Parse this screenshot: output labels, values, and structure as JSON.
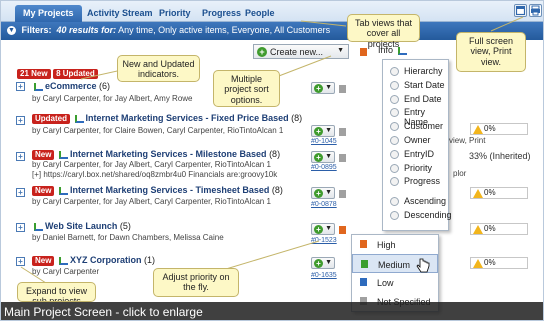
{
  "tabs": [
    {
      "label": "My Projects",
      "active": true
    },
    {
      "label": "Activity Stream",
      "active": false
    },
    {
      "label": "Priority",
      "active": false
    },
    {
      "label": "Progress",
      "active": false
    },
    {
      "label": "People",
      "active": false
    }
  ],
  "filter": {
    "label": "Filters:",
    "count": "40 results for:",
    "criteria": "Any time, Only active items, Everyone, All Customers"
  },
  "toolbar": {
    "create_label": "Create new...",
    "info_label": "Info"
  },
  "indicators": {
    "new_count": "21 New",
    "updated_count": "8 Updated"
  },
  "projects": [
    {
      "badge": "",
      "title": "eCommerce",
      "count": "(6)",
      "by": "by Caryl Carpenter, for Jay Albert, Amy Rowe",
      "line2": "",
      "id": "",
      "status": ""
    },
    {
      "badge": "Updated",
      "title": "Internet Marketing Services - Fixed Price Based",
      "count": "(8)",
      "by": "by Caryl Carpenter, for Claire Bowen, Caryl Carpenter, RioTintoAlcan 1",
      "line2": "",
      "id": "#0-1045",
      "status": "0%"
    },
    {
      "badge": "New",
      "title": "Internet Marketing Services - Milestone Based",
      "count": "(8)",
      "by": "by Caryl Carpenter, for Jay Albert, Caryl Carpenter, RioTintoAlcan 1",
      "line2": "[+] https://caryl.box.net/shared/oq8zmbr4u0 Financials are:groovy10k",
      "id": "#0-0895",
      "status": "33% (Inherited)"
    },
    {
      "badge": "New",
      "title": "Internet Marketing Services - Timesheet Based",
      "count": "(8)",
      "by": "by Caryl Carpenter, for Jay Albert, Caryl Carpenter, RioTintoAlcan 1",
      "line2": "",
      "id": "#0-0878",
      "status": "0%"
    },
    {
      "badge": "",
      "title": "Web Site Launch",
      "count": "(5)",
      "by": "by Daniel Barnett, for Dawn Chambers, Melissa Caine",
      "line2": "",
      "id": "#0-1523",
      "status": "0%"
    },
    {
      "badge": "New",
      "title": "XYZ Corporation",
      "count": "(1)",
      "by": "by Caryl Carpenter",
      "line2": "",
      "id": "#0-1635",
      "status": "0%"
    }
  ],
  "sort_options": [
    "Hierarchy",
    "Start Date",
    "End Date",
    "Entry Name",
    "Customer",
    "Owner",
    "EntryID",
    "Priority",
    "Progress",
    "Ascending",
    "Descending"
  ],
  "priority_options": [
    {
      "label": "High",
      "color": "#e0661e"
    },
    {
      "label": "Medium",
      "color": "#3a9e2f"
    },
    {
      "label": "Low",
      "color": "#2e6bbd"
    },
    {
      "label": "Not Specified",
      "color": "#a0a0a0"
    }
  ],
  "callouts": {
    "tabs": "Tab views that cover all projects",
    "fullscreen": "Full screen view, Print view.",
    "indicators": "New and Updated indicators.",
    "sort": "Multiple project sort options.",
    "priority": "Adjust priority on the fly.",
    "expand": "Expand to view sub projects"
  },
  "partial_text": {
    "view": "view, Print",
    "plor": "plor"
  },
  "caption": "Main Project Screen - click to enlarge",
  "colors": {
    "tab_active": "#2f67ad",
    "filter_bar": "#245a9c",
    "badge": "#c8221c",
    "callout_bg": "#fdf8c6"
  }
}
